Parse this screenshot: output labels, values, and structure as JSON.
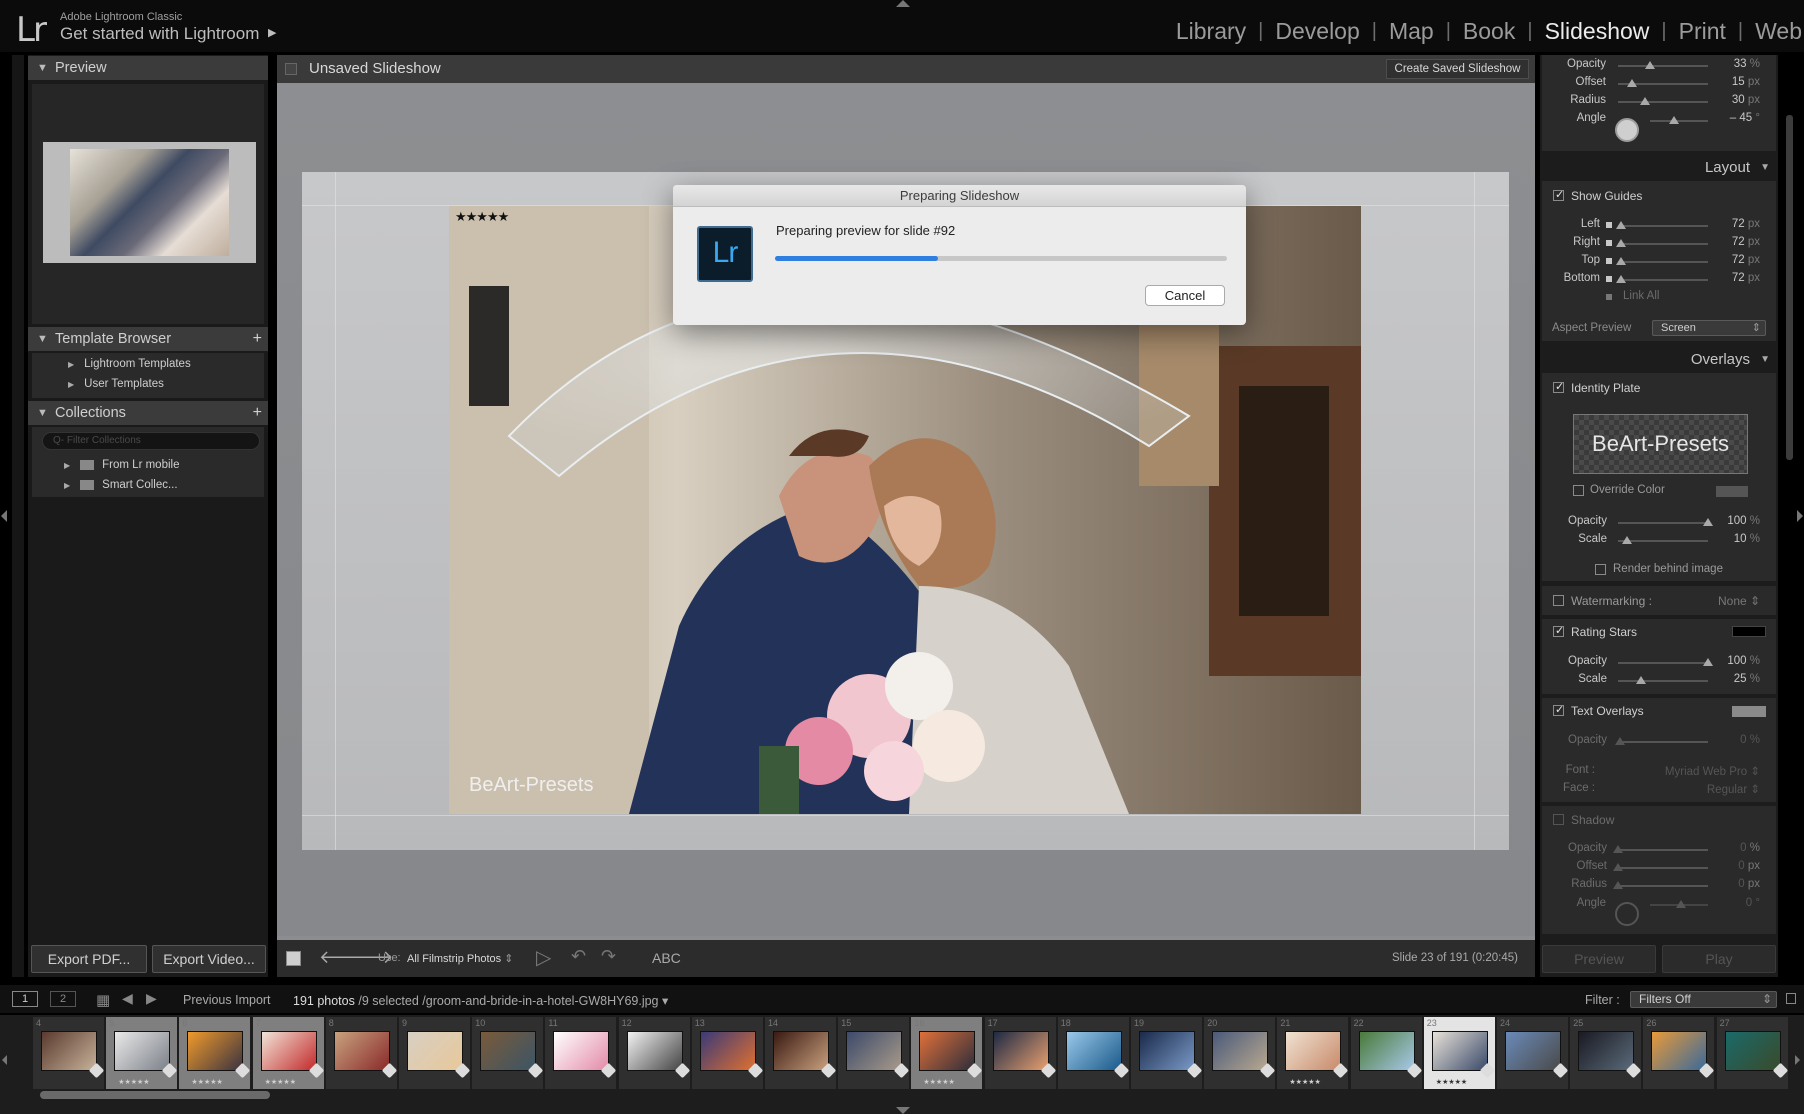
{
  "app": {
    "logo": "Lr",
    "name_small": "Adobe Lightroom Classic",
    "identity": "Get started with Lightroom",
    "arrow": "▶"
  },
  "modules": [
    {
      "label": "Library"
    },
    {
      "label": "Develop"
    },
    {
      "label": "Map"
    },
    {
      "label": "Book"
    },
    {
      "label": "Slideshow",
      "active": true
    },
    {
      "label": "Print"
    },
    {
      "label": "Web"
    }
  ],
  "left": {
    "preview_title": "Preview",
    "template_browser": {
      "title": "Template Browser",
      "plus": "+",
      "items": [
        {
          "label": "Lightroom Templates"
        },
        {
          "label": "User Templates"
        }
      ]
    },
    "collections": {
      "title": "Collections",
      "plus": "+",
      "filter_placeholder": "Q- Filter Collections",
      "items": [
        {
          "label": "From Lr mobile"
        },
        {
          "label": "Smart Collec..."
        }
      ]
    },
    "export_pdf": "Export PDF...",
    "export_video": "Export Video..."
  },
  "center": {
    "title": "Unsaved Slideshow",
    "create_saved": "Create Saved Slideshow",
    "photo_stars": "★★★★★",
    "photo_identity": "BeArt-Presets",
    "toolbar": {
      "use_label": "Use:",
      "use_value": "All Filmstrip Photos",
      "abc": "ABC",
      "slide_info": "Slide 23 of 191 (0:20:45)"
    }
  },
  "dialog": {
    "title": "Preparing Slideshow",
    "icon": "Lr",
    "message": "Preparing preview for slide #92",
    "progress": 0.36,
    "cancel": "Cancel"
  },
  "right": {
    "shadow_top": {
      "rows": [
        {
          "label": "Opacity",
          "value": "33",
          "unit": "%",
          "pos": 0.35
        },
        {
          "label": "Offset",
          "value": "15",
          "unit": "px",
          "pos": 0.15
        },
        {
          "label": "Radius",
          "value": "30",
          "unit": "px",
          "pos": 0.3
        }
      ],
      "angle_label": "Angle",
      "angle_value": "– 45",
      "angle_unit": "°"
    },
    "layout": {
      "title": "Layout",
      "show_guides": "Show Guides",
      "rows": [
        {
          "label": "Left",
          "value": "72",
          "unit": "px"
        },
        {
          "label": "Right",
          "value": "72",
          "unit": "px"
        },
        {
          "label": "Top",
          "value": "72",
          "unit": "px"
        },
        {
          "label": "Bottom",
          "value": "72",
          "unit": "px"
        }
      ],
      "link_all": "Link All",
      "aspect_label": "Aspect Preview",
      "aspect_value": "Screen"
    },
    "overlays": {
      "title": "Overlays",
      "identity_plate": "Identity Plate",
      "plate_text": "BeArt-Presets",
      "override_color": "Override Color",
      "id_rows": [
        {
          "label": "Opacity",
          "value": "100",
          "unit": "%",
          "pos": 1.0
        },
        {
          "label": "Scale",
          "value": "10",
          "unit": "%",
          "pos": 0.1
        }
      ],
      "render_behind": "Render behind image",
      "watermarking": "Watermarking :",
      "watermark_value": "None",
      "rating_stars": "Rating Stars",
      "star_rows": [
        {
          "label": "Opacity",
          "value": "100",
          "unit": "%",
          "pos": 1.0
        },
        {
          "label": "Scale",
          "value": "25",
          "unit": "%",
          "pos": 0.25
        }
      ],
      "text_overlays": "Text Overlays",
      "text_opacity": {
        "label": "Opacity",
        "value": "0",
        "unit": "%"
      },
      "font_label": "Font :",
      "font_value": "Myriad Web Pro",
      "face_label": "Face :",
      "face_value": "Regular"
    },
    "shadow": {
      "title": "Shadow",
      "rows": [
        {
          "label": "Opacity",
          "value": "0",
          "unit": "%"
        },
        {
          "label": "Offset",
          "value": "0",
          "unit": "px"
        },
        {
          "label": "Radius",
          "value": "0",
          "unit": "px"
        }
      ],
      "angle_label": "Angle",
      "angle_value": "0",
      "angle_unit": "°"
    },
    "preview_btn": "Preview",
    "play_btn": "Play"
  },
  "filmstrip_bar": {
    "page1": "1",
    "page2": "2",
    "source": "Previous Import",
    "count": "191 photos",
    "selected": "/9 selected",
    "file": "/groom-and-bride-in-a-hotel-GW8HY69.jpg",
    "filter_label": "Filter :",
    "filter_value": "Filters Off"
  },
  "thumbnails": [
    {
      "n": "4",
      "c1": "#5a3a2e",
      "c2": "#c7b29a",
      "sel": false,
      "stars": ""
    },
    {
      "n": "5",
      "c1": "#e9e9e9",
      "c2": "#7b8088",
      "sel": true,
      "stars": "★★★★★"
    },
    {
      "n": "6",
      "c1": "#f09a2a",
      "c2": "#3b3340",
      "sel": true,
      "stars": "★★★★★"
    },
    {
      "n": "7",
      "c1": "#f0e4d8",
      "c2": "#c32a2a",
      "sel": true,
      "stars": "★★★★★"
    },
    {
      "n": "8",
      "c1": "#c8a27e",
      "c2": "#8a2a2a",
      "sel": false,
      "stars": ""
    },
    {
      "n": "9",
      "c1": "#d8cfc2",
      "c2": "#e8c89a",
      "sel": false,
      "stars": ""
    },
    {
      "n": "10",
      "c1": "#7a5a3a",
      "c2": "#3b5566",
      "sel": false,
      "stars": ""
    },
    {
      "n": "11",
      "c1": "#ffffff",
      "c2": "#e38aa8",
      "sel": false,
      "stars": ""
    },
    {
      "n": "12",
      "c1": "#f2f2f2",
      "c2": "#444",
      "sel": false,
      "stars": ""
    },
    {
      "n": "13",
      "c1": "#3a3a78",
      "c2": "#e07030",
      "sel": false,
      "stars": ""
    },
    {
      "n": "14",
      "c1": "#3a1a12",
      "c2": "#c9a07e",
      "sel": false,
      "stars": ""
    },
    {
      "n": "15",
      "c1": "#3c4a6a",
      "c2": "#a89a8a",
      "sel": false,
      "stars": ""
    },
    {
      "n": "16",
      "c1": "#e0703a",
      "c2": "#2d2d3a",
      "sel": true,
      "stars": "★★★★★"
    },
    {
      "n": "17",
      "c1": "#1d2a44",
      "c2": "#e8a070",
      "sel": false,
      "stars": ""
    },
    {
      "n": "18",
      "c1": "#9ac8ea",
      "c2": "#1a5a8a",
      "sel": false,
      "stars": ""
    },
    {
      "n": "19",
      "c1": "#1a2a4a",
      "c2": "#7a9ac8",
      "sel": false,
      "stars": ""
    },
    {
      "n": "20",
      "c1": "#4a5a7a",
      "c2": "#b8a890",
      "sel": false,
      "stars": ""
    },
    {
      "n": "21",
      "c1": "#f0e2d2",
      "c2": "#c88a6a",
      "sel": false,
      "stars": "★★★★★"
    },
    {
      "n": "22",
      "c1": "#4a7a3a",
      "c2": "#a8c8e8",
      "sel": false,
      "stars": ""
    },
    {
      "n": "23",
      "c1": "#e8e2d8",
      "c2": "#3a4a6a",
      "sel": true,
      "cur": true,
      "stars": "★★★★★"
    },
    {
      "n": "24",
      "c1": "#6a8ab8",
      "c2": "#4a4a4a",
      "sel": false,
      "stars": ""
    },
    {
      "n": "25",
      "c1": "#1a1a22",
      "c2": "#5a6a7a",
      "sel": false,
      "stars": ""
    },
    {
      "n": "26",
      "c1": "#e89a3a",
      "c2": "#3a6a9a",
      "sel": false,
      "stars": ""
    },
    {
      "n": "27",
      "c1": "#1a6a6a",
      "c2": "#3a4a2a",
      "sel": false,
      "stars": ""
    }
  ]
}
